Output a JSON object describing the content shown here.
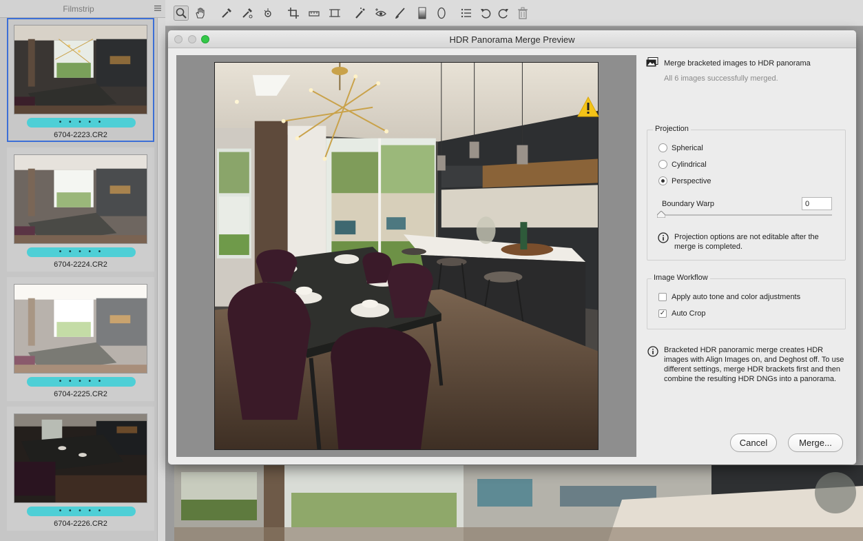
{
  "filmstrip": {
    "title": "Filmstrip",
    "items": [
      {
        "name": "6704-2223.CR2",
        "rating": "• • • • •",
        "selected": true
      },
      {
        "name": "6704-2224.CR2",
        "rating": "• • • • •",
        "selected": false
      },
      {
        "name": "6704-2225.CR2",
        "rating": "• • • • •",
        "selected": false
      },
      {
        "name": "6704-2226.CR2",
        "rating": "• • • • •",
        "selected": false
      }
    ]
  },
  "toolbar": {
    "tools": [
      "zoom-icon",
      "hand-icon",
      "white-balance-icon",
      "color-sampler-icon",
      "targeted-adjustment-icon",
      "crop-icon",
      "straighten-icon",
      "transform-icon",
      "spot-removal-icon",
      "red-eye-icon",
      "brush-icon",
      "graduated-filter-icon",
      "radial-filter-icon",
      "presets-list-icon",
      "rotate-left-icon",
      "rotate-right-icon",
      "trash-icon"
    ]
  },
  "dialog": {
    "title": "HDR Panorama Merge Preview",
    "merge_title": "Merge bracketed images to HDR panorama",
    "merge_status": "All 6 images successfully merged.",
    "projection": {
      "label": "Projection",
      "options": [
        "Spherical",
        "Cylindrical",
        "Perspective"
      ],
      "selected": "Perspective",
      "boundary_warp_label": "Boundary Warp",
      "boundary_warp_value": "0",
      "note": "Projection options are not editable after the merge is completed."
    },
    "workflow": {
      "label": "Image Workflow",
      "auto_tone_label": "Apply auto tone and color adjustments",
      "auto_tone_checked": false,
      "auto_crop_label": "Auto Crop",
      "auto_crop_checked": true
    },
    "info_note": "Bracketed HDR panoramic merge creates HDR images with Align Images on, and Deghost off. To use different settings, merge HDR brackets first and then combine the resulting HDR DNGs into a panorama.",
    "cancel_label": "Cancel",
    "merge_label": "Merge...",
    "colors": {
      "rating_bar": "#4ecfd6",
      "selection": "#3c6fd6",
      "warning": "#f3c318",
      "zoom_button": "#34c748"
    }
  }
}
